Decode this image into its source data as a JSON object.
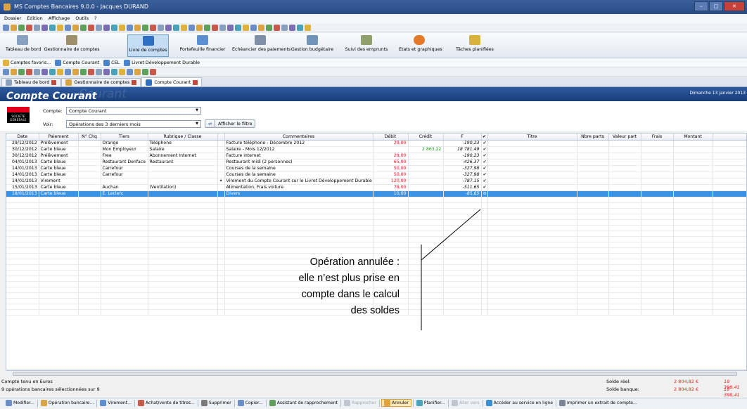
{
  "window": {
    "title": "MS Comptes Bancaires 9.0.0 - Jacques DURAND",
    "controls": [
      "–",
      "□",
      "✕"
    ]
  },
  "menu": [
    "Dossier",
    "Edition",
    "Affichage",
    "Outils",
    "?"
  ],
  "ribbon": [
    {
      "label": "Tableau de bord",
      "icon": "dashboard-icon",
      "color": "#8aa0bf"
    },
    {
      "label": "Gestionnaire de comptes",
      "icon": "bank-icon",
      "color": "#9c8f6a"
    },
    {
      "label": "Livre de comptes",
      "icon": "book-icon",
      "color": "#2e6fc4",
      "active": true
    },
    {
      "label": "Portefeuille financier",
      "icon": "portfolio-icon",
      "color": "#5b8fd1"
    },
    {
      "label": "Echéancier des paiements",
      "icon": "schedule-icon",
      "color": "#7f8fa8"
    },
    {
      "label": "Gestion budgétaire",
      "icon": "budget-icon",
      "color": "#6f94b8"
    },
    {
      "label": "Suivi des emprunts",
      "icon": "house-icon",
      "color": "#8fa06a"
    },
    {
      "label": "Etats et graphiques",
      "icon": "pie-chart-icon",
      "color": "#e37a2a"
    },
    {
      "label": "Tâches planifiées",
      "icon": "task-icon",
      "color": "#d8b33a"
    }
  ],
  "favorites": [
    {
      "label": "Comptes favoris..."
    },
    {
      "label": "Compte Courant"
    },
    {
      "label": "CEL"
    },
    {
      "label": "Livret Développement Durable"
    }
  ],
  "tabs": [
    {
      "label": "Tableau de bord"
    },
    {
      "label": "Gestionnaire de comptes"
    },
    {
      "label": "Compte Courant",
      "active": true
    }
  ],
  "header": {
    "title": "Compte Courant",
    "ghost": "Courant",
    "date": "Dimanche 13 janvier 2013"
  },
  "filters": {
    "logo_text": "SOCIETE GENERALE",
    "account_label": "Compte:",
    "account_value": "Compte Courant",
    "view_label": "Voir:",
    "view_value": "Opérations des 3 derniers mois",
    "apply_button": "Afficher le filtre"
  },
  "table": {
    "columns": [
      "Date",
      "Paiement",
      "N° Chq",
      "Tiers",
      "Rubrique / Classe",
      "",
      "Commentaires",
      "Débit",
      "Crédit",
      "F",
      "✔",
      "Titre",
      "Nbre parts",
      "Valeur part",
      "Frais",
      "Montant"
    ],
    "rows": [
      {
        "date": "29/12/2012",
        "payment": "Prélèvement",
        "chq": "",
        "payee": "Orange",
        "category": "Téléphone",
        "mark": "",
        "comment": "Facture téléphone - Décembre 2012",
        "debit": "29,00",
        "credit": "",
        "balance": "-190,23",
        "check": "✔"
      },
      {
        "date": "30/12/2012",
        "payment": "Carte bleue",
        "chq": "",
        "payee": "Mon Employeur",
        "category": "Salaire",
        "mark": "",
        "comment": "Salaire - Mois 12/2012",
        "debit": "",
        "credit": "2 863,22",
        "balance": "18 781,49",
        "check": "✔"
      },
      {
        "date": "30/12/2012",
        "payment": "Prélèvement",
        "chq": "",
        "payee": "Free",
        "category": "Abonnement Internet",
        "mark": "",
        "comment": "Facture internet",
        "debit": "29,00",
        "credit": "",
        "balance": "-190,23",
        "check": "✔"
      },
      {
        "date": "04/01/2013",
        "payment": "Carte bleue",
        "chq": "",
        "payee": "Restaurant Denface",
        "category": "Restaurant",
        "mark": "",
        "comment": "Restaurant midi (2 personnes)",
        "debit": "65,00",
        "credit": "",
        "balance": "-426,37",
        "check": "✔"
      },
      {
        "date": "14/01/2013",
        "payment": "Carte bleue",
        "chq": "",
        "payee": "Carrefour",
        "category": "",
        "mark": "",
        "comment": "Courses de la semaine",
        "debit": "50,00",
        "credit": "",
        "balance": "-327,98",
        "check": "✔"
      },
      {
        "date": "14/01/2013",
        "payment": "Carte bleue",
        "chq": "",
        "payee": "Carrefour",
        "category": "",
        "mark": "",
        "comment": "Courses de la semaine",
        "debit": "50,00",
        "credit": "",
        "balance": "-327,98",
        "check": "✔"
      },
      {
        "date": "14/01/2013",
        "payment": "Virement",
        "chq": "",
        "payee": "",
        "category": "",
        "mark": "✦",
        "comment": "Virement du Compte Courant sur le Livret Développement Durable",
        "debit": "120,00",
        "credit": "",
        "balance": "-787,15",
        "check": "✔"
      },
      {
        "date": "15/01/2013",
        "payment": "Carte bleue",
        "chq": "",
        "payee": "Auchan",
        "category": "(Ventilation)",
        "mark": "",
        "comment": "Alimentation, Frais voiture",
        "debit": "78,00",
        "credit": "",
        "balance": "-511,65",
        "check": "✔"
      },
      {
        "date": "18/01/2013",
        "payment": "Carte bleue",
        "chq": "",
        "payee": "E. Leclerc",
        "category": "",
        "mark": "",
        "comment": "Divers",
        "debit": "10,00",
        "credit": "",
        "balance": "-85,65",
        "check": "⊘",
        "selected": true
      }
    ]
  },
  "annotation": {
    "lines": [
      "Opération annulée :",
      "elle n’est plus prise en",
      "compte dans le calcul",
      "des soldes"
    ]
  },
  "status": {
    "currency": "Compte tenu en  Euros",
    "selection": "9 opérations bancaires sélectionnées sur 9",
    "real_label": "Solde réel:",
    "real_value": "2 804,82 €",
    "real_total": "18 398,41",
    "bank_label": "Solde banque:",
    "bank_value": "2 804,82 €",
    "bank_total": "18 398,41"
  },
  "actions": [
    {
      "label": "Modifier...",
      "icon": "edit-icon"
    },
    {
      "label": "Opération bancaire...",
      "icon": "operation-icon"
    },
    {
      "label": "Virement...",
      "icon": "transfer-icon"
    },
    {
      "label": "Achat/vente de titres...",
      "icon": "shares-icon"
    },
    {
      "label": "Supprimer",
      "icon": "delete-icon"
    },
    {
      "label": "Copier...",
      "icon": "copy-icon"
    },
    {
      "label": "Assistant de rapprochement",
      "icon": "reconcile-icon"
    },
    {
      "label": "Rapprocher",
      "icon": "check-icon",
      "disabled": true
    },
    {
      "label": "Annuler",
      "icon": "cancel-icon",
      "pressed": true
    },
    {
      "label": "Planifier...",
      "icon": "schedule-icon"
    },
    {
      "label": "Aller vers",
      "icon": "goto-icon",
      "disabled": true
    },
    {
      "label": "Accéder au service en ligne",
      "icon": "online-icon"
    },
    {
      "label": "Imprimer un extrait de compte...",
      "icon": "print-icon"
    }
  ]
}
